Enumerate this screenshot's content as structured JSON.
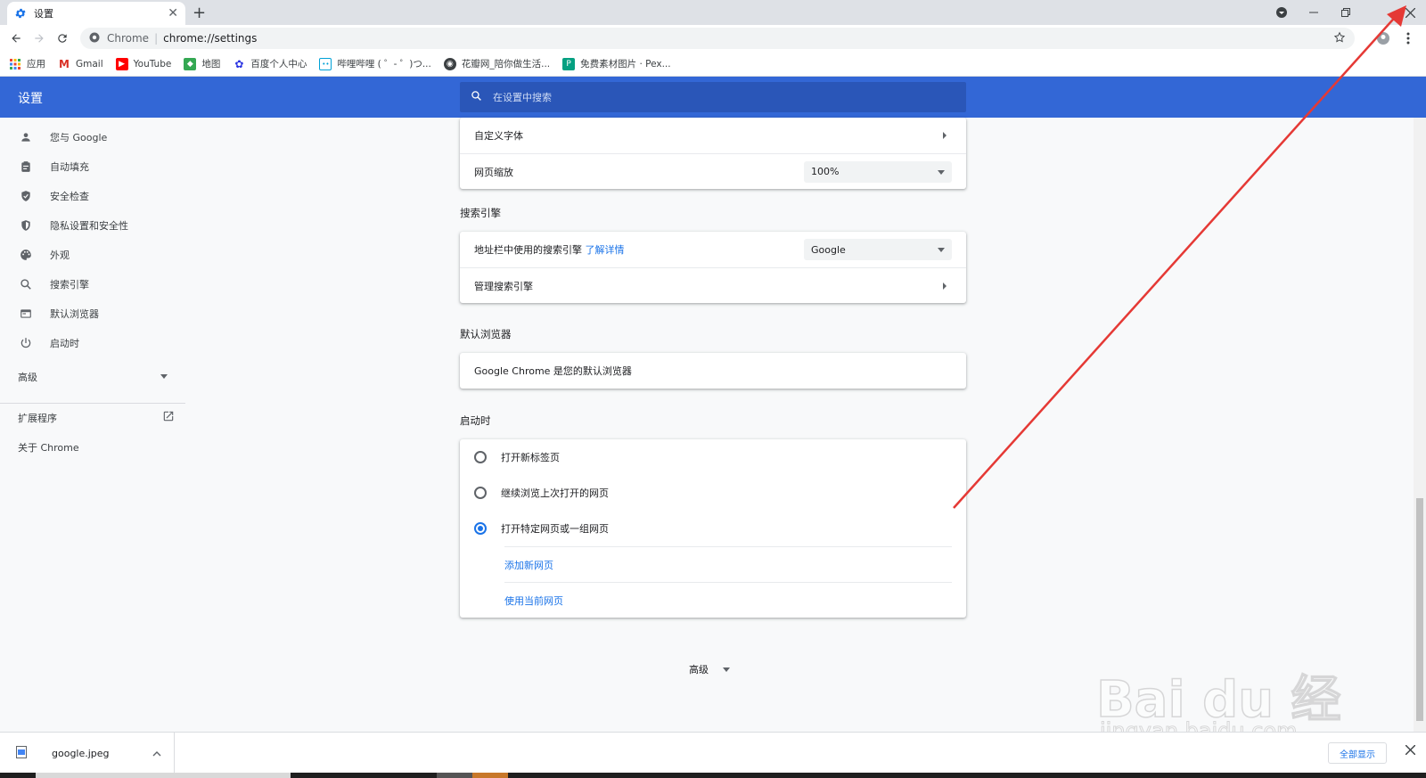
{
  "browser": {
    "tab_title": "设置",
    "address_site": "Chrome",
    "address_url": "chrome://settings"
  },
  "bookmarks": [
    {
      "label": "应用",
      "color": "#ea4335"
    },
    {
      "label": "Gmail",
      "color": "#d93025"
    },
    {
      "label": "YouTube",
      "color": "#ff0000"
    },
    {
      "label": "地图",
      "color": "#34a853"
    },
    {
      "label": "百度个人中心",
      "color": "#2932e1"
    },
    {
      "label": "哔哩哔哩 ( ゜- ゜)つ...",
      "color": "#00a1d6"
    },
    {
      "label": "花瓣网_陪你做生活...",
      "color": "#3c4043"
    },
    {
      "label": "免费素材图片 · Pex...",
      "color": "#05a081"
    }
  ],
  "settings": {
    "header_title": "设置",
    "search_placeholder": "在设置中搜索",
    "sidebar": [
      {
        "label": "您与 Google"
      },
      {
        "label": "自动填充"
      },
      {
        "label": "安全检查"
      },
      {
        "label": "隐私设置和安全性"
      },
      {
        "label": "外观"
      },
      {
        "label": "搜索引擎"
      },
      {
        "label": "默认浏览器"
      },
      {
        "label": "启动时"
      }
    ],
    "sidebar_advanced": "高级",
    "sidebar_extensions": "扩展程序",
    "sidebar_about": "关于 Chrome",
    "appearance": {
      "custom_fonts": "自定义字体",
      "page_zoom_label": "网页缩放",
      "page_zoom_value": "100%"
    },
    "search_engine": {
      "section_title": "搜索引擎",
      "address_bar_label": "地址栏中使用的搜索引擎",
      "learn_more": "了解详情",
      "engine_value": "Google",
      "manage_label": "管理搜索引擎"
    },
    "default_browser": {
      "section_title": "默认浏览器",
      "status": "Google Chrome 是您的默认浏览器"
    },
    "on_startup": {
      "section_title": "启动时",
      "options": [
        {
          "label": "打开新标签页",
          "selected": false
        },
        {
          "label": "继续浏览上次打开的网页",
          "selected": false
        },
        {
          "label": "打开特定网页或一组网页",
          "selected": true
        }
      ],
      "add_page": "添加新网页",
      "use_current": "使用当前网页"
    },
    "advanced_bottom": "高级"
  },
  "downloads": {
    "file_name": "google.jpeg",
    "show_all": "全部显示"
  },
  "watermark": {
    "brand": "Bai du 经验",
    "domain": "jingyan.baidu.com"
  },
  "colors": {
    "accent": "#3367d6",
    "link": "#1a73e8",
    "arrow": "#e53935"
  }
}
